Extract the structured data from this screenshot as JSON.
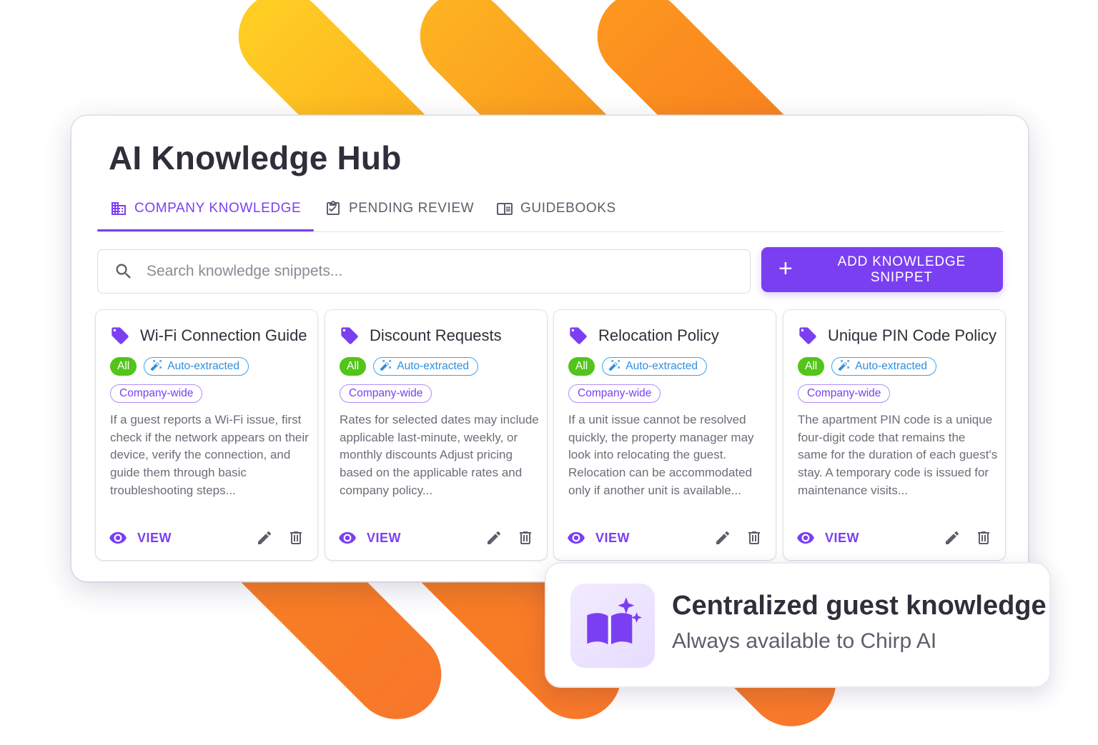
{
  "page": {
    "title": "AI Knowledge Hub"
  },
  "tabs": [
    {
      "label": "COMPANY KNOWLEDGE",
      "icon": "building-icon",
      "active": true
    },
    {
      "label": "PENDING REVIEW",
      "icon": "clipboard-check-icon",
      "active": false
    },
    {
      "label": "GUIDEBOOKS",
      "icon": "book-icon",
      "active": false
    }
  ],
  "search": {
    "placeholder": "Search knowledge snippets...",
    "value": ""
  },
  "toolbar": {
    "add_label": "ADD KNOWLEDGE SNIPPET"
  },
  "cards": [
    {
      "title": "Wi-Fi Connection Guide",
      "chips": {
        "all": "All",
        "auto": "Auto-extracted",
        "scope": "Company-wide"
      },
      "description": "If a guest reports a Wi-Fi issue, first check if the network appears on their device, verify the connection, and guide them through basic troubleshooting steps...",
      "view_label": "VIEW"
    },
    {
      "title": "Discount Requests",
      "chips": {
        "all": "All",
        "auto": "Auto-extracted",
        "scope": "Company-wide"
      },
      "description": "Rates for selected dates may include applicable last-minute, weekly, or monthly discounts Adjust pricing based on the applicable rates and company policy...",
      "view_label": "VIEW"
    },
    {
      "title": "Relocation Policy",
      "chips": {
        "all": "All",
        "auto": "Auto-extracted",
        "scope": "Company-wide"
      },
      "description": "If a unit issue cannot be resolved quickly, the property manager may look into relocating the guest. Relocation can be accommodated only if another unit is available...",
      "view_label": "VIEW"
    },
    {
      "title": "Unique PIN Code Policy",
      "chips": {
        "all": "All",
        "auto": "Auto-extracted",
        "scope": "Company-wide"
      },
      "description": "The apartment PIN code is a unique four-digit code that remains the same for the duration of each guest's stay. A temporary code is issued for maintenance visits...",
      "view_label": "VIEW"
    }
  ],
  "info": {
    "title": "Centralized guest knowledge",
    "subtitle": "Always available to Chirp AI",
    "icon": "book-sparkle-icon"
  },
  "colors": {
    "accent": "#7b3ff2",
    "chip_all": "#52c41a",
    "chip_auto": "#2d8fe0",
    "stripe_yellow": "#fdb321",
    "stripe_orange": "#f98020"
  }
}
